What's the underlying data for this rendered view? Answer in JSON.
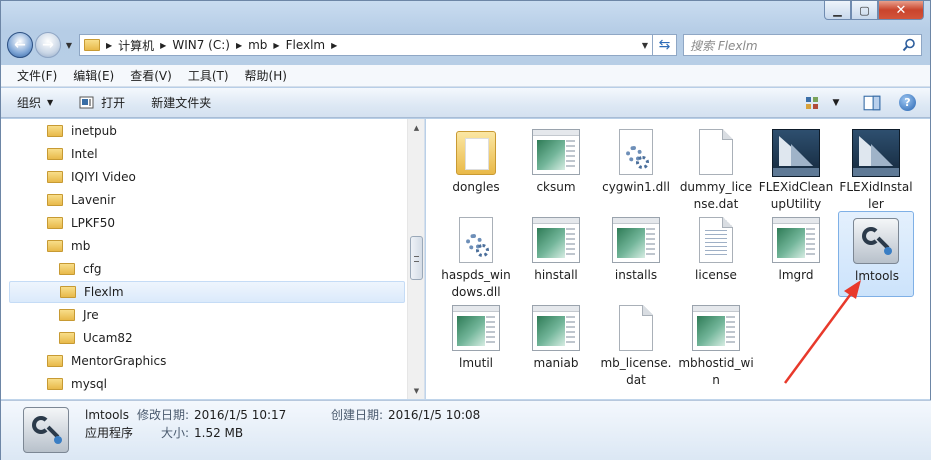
{
  "address": {
    "crumbs": [
      "计算机",
      "WIN7 (C:)",
      "mb",
      "Flexlm"
    ]
  },
  "search": {
    "placeholder": "搜索 Flexlm"
  },
  "menu": [
    "文件(F)",
    "编辑(E)",
    "查看(V)",
    "工具(T)",
    "帮助(H)"
  ],
  "toolbar": {
    "organize": "组织",
    "open": "打开",
    "new_folder": "新建文件夹"
  },
  "tree": [
    {
      "label": "inetpub",
      "level": 0
    },
    {
      "label": "Intel",
      "level": 0
    },
    {
      "label": "IQIYI Video",
      "level": 0
    },
    {
      "label": "Lavenir",
      "level": 0
    },
    {
      "label": "LPKF50",
      "level": 0
    },
    {
      "label": "mb",
      "level": 0
    },
    {
      "label": "cfg",
      "level": 1
    },
    {
      "label": "Flexlm",
      "level": 1,
      "selected": true
    },
    {
      "label": "Jre",
      "level": 1
    },
    {
      "label": "Ucam82",
      "level": 1
    },
    {
      "label": "MentorGraphics",
      "level": 0
    },
    {
      "label": "mysql",
      "level": 0
    }
  ],
  "files": [
    {
      "name": "dongles",
      "icon": "folder-icon"
    },
    {
      "name": "cksum",
      "icon": "application-icon"
    },
    {
      "name": "cygwin1.dll",
      "icon": "dll-gear-icon"
    },
    {
      "name": "dummy_license.dat",
      "icon": "blank-document-icon"
    },
    {
      "name": "FLEXidCleanupUtility",
      "icon": "flexid-sail-icon"
    },
    {
      "name": "FLEXidInstaller",
      "icon": "flexid-sail-icon"
    },
    {
      "name": "haspds_windows.dll",
      "icon": "dll-gear-icon"
    },
    {
      "name": "hinstall",
      "icon": "application-icon"
    },
    {
      "name": "installs",
      "icon": "application-icon"
    },
    {
      "name": "license",
      "icon": "lined-document-icon"
    },
    {
      "name": "lmgrd",
      "icon": "application-icon"
    },
    {
      "name": "lmtools",
      "icon": "lmtools-icon",
      "selected": true
    },
    {
      "name": "lmutil",
      "icon": "application-icon"
    },
    {
      "name": "maniab",
      "icon": "application-icon"
    },
    {
      "name": "mb_license.dat",
      "icon": "blank-document-icon"
    },
    {
      "name": "mbhostid_win",
      "icon": "application-icon"
    }
  ],
  "details": {
    "name": "lmtools",
    "type": "应用程序",
    "modified_label": "修改日期:",
    "modified_value": "2016/1/5 10:17",
    "created_label": "创建日期:",
    "created_value": "2016/1/5 10:08",
    "size_label": "大小:",
    "size_value": "1.52 MB"
  },
  "colors": {
    "selection": "#cce3fb",
    "annotation_arrow": "#e8392b"
  }
}
